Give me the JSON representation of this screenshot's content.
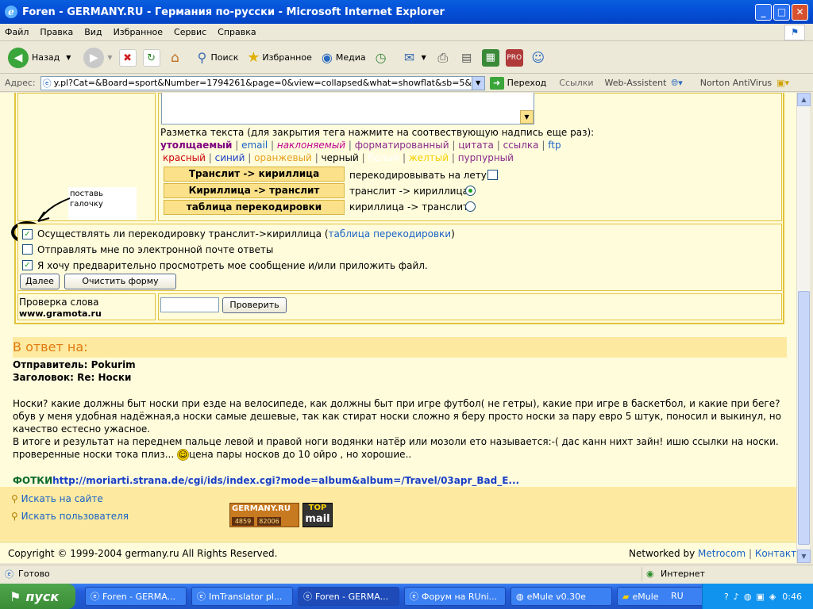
{
  "window": {
    "title": "Foren - GERMANY.RU - Германия по-русски - Microsoft Internet Explorer"
  },
  "menu": [
    "Файл",
    "Правка",
    "Вид",
    "Избранное",
    "Сервис",
    "Справка"
  ],
  "toolbar": {
    "back": "Назад",
    "search": "Поиск",
    "favorites": "Избранное",
    "media": "Медиа"
  },
  "address": {
    "label": "Адрес:",
    "url": "y.pl?Cat=&Board=sport&Number=1794261&page=0&view=collapsed&what=showflat&sb=5&part=1&vc=1",
    "go": "Переход",
    "links": "Ссылки",
    "webassistant": "Web-Assistent",
    "norton": "Norton AntiVirus"
  },
  "markup": {
    "title": "Разметка текста (для закрытия тега нажмите на соотвествующую надпись еще раз):",
    "row1": [
      "утолщаемый",
      "email",
      "наклоняемый",
      "форматированный",
      "цитата",
      "ссылка",
      "ftp"
    ],
    "row2": [
      "красный",
      "синий",
      "оранжевый",
      "черный",
      "белый",
      "желтый",
      "пурпурный"
    ],
    "colors": {
      "bold": "#800080",
      "email": "#1a63c6",
      "italic": "#c0008f",
      "formatted": "#8a2a8a",
      "quote": "#8a2a8a",
      "link": "#8a2a8a",
      "ftp": "#1a63c6",
      "red": "#cc0000",
      "blue": "#1a3fc6",
      "orange": "#e8a020",
      "black": "#000000",
      "white": "#ffffff",
      "yellow": "#f5d000",
      "purple": "#8a2a8a"
    }
  },
  "translit": {
    "btn1": "Транслит -> кириллица",
    "btn2": "Кириллица -> транслит",
    "btn3": "таблица перекодировки",
    "opt1": "перекодировывать на лету:",
    "opt2": "транслит -> кириллица",
    "opt3": "кириллица -> транслит"
  },
  "note": {
    "line1": "поставь",
    "line2": "галочку"
  },
  "options": {
    "opt1": "Осуществлять ли перекодировку транслит->кириллица (",
    "opt1_link": "таблица перекодировки",
    "opt1_end": ")",
    "opt2": "Отправлять мне по электронной почте ответы",
    "opt3": "Я хочу предварительно просмотреть мое сообщение и/или приложить файл."
  },
  "buttons": {
    "next": "Далее",
    "clear": "Очистить форму",
    "check": "Проверить"
  },
  "wordcheck": {
    "label": "Проверка слова",
    "site": "www.gramota.ru"
  },
  "reply": {
    "header": "В ответ на:",
    "sender": "Отправитель: Pokurim",
    "subject": "Заголовок: Re: Носки",
    "p1": "Носки? какие должны быт носки при езде на велосипеде, как должны быт при игре футбол( не гетры), какие при игре в баскетбол, и какие при беге?",
    "p2": "обув у меня удобная надёжная,а носки самые дешевые, так как стират носки сложно я беру просто носки за пару евро 5 штук, поносил и выкинул, но качество естесно ужасное.",
    "p3a": "В итоге и результат на переднем пальце левой и правой ноги водянки натёр или мозоли ето называется:-( дас канн нихт зайн! ишю ссылки на носки. проверенные носки тока плиз...",
    "p3b": "цена пары носков до 10 ойро , но хорошие..",
    "foto_label": "ФОТКИ",
    "foto_url": "http://moriarti.strana.de/cgi/ids/index.cgi?mode=album&album=/Travel/03apr_Bad_E..."
  },
  "footer": {
    "search_site": "Искать на сайте",
    "search_user": "Искать пользователя",
    "badge1_title": "GERMANY.RU",
    "badge1_n1": "4859",
    "badge1_n2": "82006",
    "badge2_top": "TOP",
    "badge2_bottom": "mail",
    "copyright": "Copyright © 1999-2004 germany.ru All Rights Reserved.",
    "networked": "Networked by",
    "metrocom": "Metrocom",
    "contact": "Контакт"
  },
  "status": {
    "text": "Готово",
    "zone": "Интернет"
  },
  "taskbar": {
    "start": "пуск",
    "tasks": [
      "Foren - GERMA...",
      "ImTranslator pl...",
      "Foren - GERMA...",
      "Форум на RUni...",
      "eMule v0.30e",
      "eMule"
    ],
    "lang": "RU",
    "clock": "0:46"
  }
}
